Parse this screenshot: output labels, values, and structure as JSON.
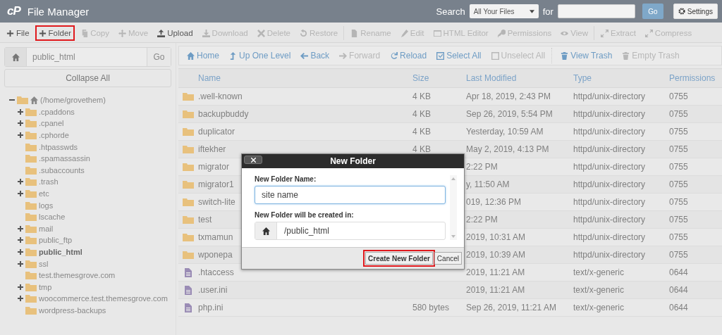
{
  "header": {
    "logo": "cP",
    "title": "File Manager",
    "search_label": "Search",
    "search_scope": "All Your Files",
    "for_label": "for",
    "go": "Go",
    "settings": "Settings"
  },
  "toolbar": [
    {
      "label": "File",
      "disabled": false,
      "highlighted": false
    },
    {
      "label": "Folder",
      "disabled": false,
      "highlighted": true
    },
    {
      "label": "Copy",
      "disabled": true,
      "highlighted": false
    },
    {
      "label": "Move",
      "disabled": true,
      "highlighted": false
    },
    {
      "label": "Upload",
      "disabled": false,
      "highlighted": false
    },
    {
      "label": "Download",
      "disabled": true,
      "highlighted": false
    },
    {
      "label": "Delete",
      "disabled": true,
      "highlighted": false
    },
    {
      "label": "Restore",
      "disabled": true,
      "highlighted": false
    },
    {
      "label": "Rename",
      "disabled": true,
      "highlighted": false
    },
    {
      "label": "Edit",
      "disabled": true,
      "highlighted": false
    },
    {
      "label": "HTML Editor",
      "disabled": true,
      "highlighted": false
    },
    {
      "label": "Permissions",
      "disabled": true,
      "highlighted": false
    },
    {
      "label": "View",
      "disabled": true,
      "highlighted": false
    },
    {
      "label": "Extract",
      "disabled": true,
      "highlighted": false
    },
    {
      "label": "Compress",
      "disabled": true,
      "highlighted": false
    }
  ],
  "sidebar": {
    "path": "public_html",
    "go": "Go",
    "collapse": "Collapse All",
    "tree": [
      {
        "label": "(/home/grovethem)",
        "expanded": true,
        "selected": false,
        "children": [
          {
            "label": ".cpaddons",
            "expandable": true,
            "selected": false
          },
          {
            "label": ".cpanel",
            "expandable": true,
            "selected": false
          },
          {
            "label": ".cphorde",
            "expandable": true,
            "selected": false
          },
          {
            "label": ".htpasswds",
            "expandable": false,
            "selected": false
          },
          {
            "label": ".spamassassin",
            "expandable": false,
            "selected": false
          },
          {
            "label": ".subaccounts",
            "expandable": false,
            "selected": false
          },
          {
            "label": ".trash",
            "expandable": true,
            "selected": false
          },
          {
            "label": "etc",
            "expandable": true,
            "selected": false
          },
          {
            "label": "logs",
            "expandable": false,
            "selected": false
          },
          {
            "label": "lscache",
            "expandable": false,
            "selected": false
          },
          {
            "label": "mail",
            "expandable": true,
            "selected": false
          },
          {
            "label": "public_ftp",
            "expandable": true,
            "selected": false
          },
          {
            "label": "public_html",
            "expandable": true,
            "selected": true
          },
          {
            "label": "ssl",
            "expandable": true,
            "selected": false
          },
          {
            "label": "test.themesgrove.com",
            "expandable": false,
            "selected": false
          },
          {
            "label": "tmp",
            "expandable": true,
            "selected": false
          },
          {
            "label": "woocommerce.test.themesgrove.com",
            "expandable": true,
            "selected": false
          },
          {
            "label": "wordpress-backups",
            "expandable": false,
            "selected": false
          }
        ]
      }
    ]
  },
  "nav": [
    {
      "label": "Home",
      "disabled": false
    },
    {
      "label": "Up One Level",
      "disabled": false
    },
    {
      "label": "Back",
      "disabled": false
    },
    {
      "label": "Forward",
      "disabled": true
    },
    {
      "label": "Reload",
      "disabled": false
    },
    {
      "label": "Select All",
      "disabled": false
    },
    {
      "label": "Unselect All",
      "disabled": true
    },
    {
      "label": "View Trash",
      "disabled": false
    },
    {
      "label": "Empty Trash",
      "disabled": true
    }
  ],
  "table": {
    "columns": [
      "Name",
      "Size",
      "Last Modified",
      "Type",
      "Permissions"
    ],
    "rows": [
      {
        "kind": "folder",
        "name": ".well-known",
        "size": "4 KB",
        "modified": "Apr 18, 2019, 2:43 PM",
        "type": "httpd/unix-directory",
        "permissions": "0755"
      },
      {
        "kind": "folder",
        "name": "backupbuddy",
        "size": "4 KB",
        "modified": "Sep 26, 2019, 5:54 PM",
        "type": "httpd/unix-directory",
        "permissions": "0755"
      },
      {
        "kind": "folder",
        "name": "duplicator",
        "size": "4 KB",
        "modified": "Yesterday, 10:59 AM",
        "type": "httpd/unix-directory",
        "permissions": "0755"
      },
      {
        "kind": "folder",
        "name": "iftekher",
        "size": "4 KB",
        "modified": "May 2, 2019, 4:13 PM",
        "type": "httpd/unix-directory",
        "permissions": "0755"
      },
      {
        "kind": "folder",
        "name": "migrator",
        "modified": "2:22 PM",
        "type": "httpd/unix-directory",
        "permissions": "0755"
      },
      {
        "kind": "folder",
        "name": "migrator1",
        "modified": "y, 11:50 AM",
        "type": "httpd/unix-directory",
        "permissions": "0755"
      },
      {
        "kind": "folder",
        "name": "switch-lite",
        "modified": "019, 12:36 PM",
        "type": "httpd/unix-directory",
        "permissions": "0755"
      },
      {
        "kind": "folder",
        "name": "test",
        "modified": "2:22 PM",
        "type": "httpd/unix-directory",
        "permissions": "0755"
      },
      {
        "kind": "folder",
        "name": "txmamun",
        "modified": "2019, 10:31 AM",
        "type": "httpd/unix-directory",
        "permissions": "0755"
      },
      {
        "kind": "folder",
        "name": "wponepa",
        "modified": "2019, 10:39 AM",
        "type": "httpd/unix-directory",
        "permissions": "0755"
      },
      {
        "kind": "file",
        "name": ".htaccess",
        "modified": "2019, 11:21 AM",
        "type": "text/x-generic",
        "permissions": "0644"
      },
      {
        "kind": "file",
        "name": ".user.ini",
        "modified": "2019, 11:21 AM",
        "type": "text/x-generic",
        "permissions": "0644"
      },
      {
        "kind": "file",
        "name": "php.ini",
        "size": "580 bytes",
        "modified": "Sep 26, 2019, 11:21 AM",
        "type": "text/x-generic",
        "permissions": "0644"
      }
    ]
  },
  "dialog": {
    "title": "New Folder",
    "name_label": "New Folder Name:",
    "name_value": "site name",
    "location_label": "New Folder will be created in:",
    "location_value": "/public_html",
    "buttons": [
      {
        "label": "Create New Folder",
        "highlighted": true
      },
      {
        "label": "Cancel",
        "highlighted": false
      }
    ]
  }
}
